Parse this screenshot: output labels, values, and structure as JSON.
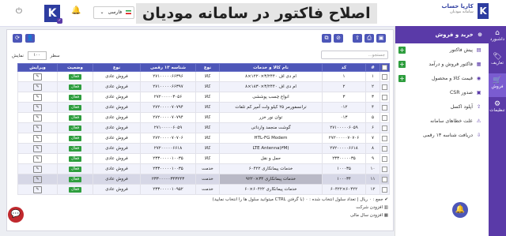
{
  "header": {
    "logo_text": "کارپا حساب",
    "logo_sub": "سامانه مودیان",
    "banner": "اصلاح فاکتور در سامانه مودیان",
    "language": "فارسی",
    "notification_count": "0"
  },
  "rail": [
    {
      "icon": "⌂",
      "label": "داشبورد",
      "icon_name": "home-icon"
    },
    {
      "icon": "🏷",
      "label": "تعاریف",
      "icon_name": "tag-icon"
    },
    {
      "icon": "🛒",
      "label": "فروش",
      "icon_name": "cart-icon"
    },
    {
      "icon": "⚙",
      "label": "تنظیمات",
      "icon_name": "gear-icon"
    }
  ],
  "menu": {
    "header": "خرید و فروش",
    "items": [
      {
        "label": "پیش فاکتور",
        "icon": "▤",
        "icon_name": "invoice-icon",
        "plus": true
      },
      {
        "label": "فاکتور فروش و درآمد",
        "icon": "▦",
        "icon_name": "receipt-icon",
        "plus": true
      },
      {
        "label": "قیمت کالا و محصول",
        "icon": "◉",
        "icon_name": "price-icon",
        "plus": true
      },
      {
        "label": "صدور CSR",
        "icon": "▣",
        "icon_name": "certificate-icon",
        "plus": false
      },
      {
        "label": "آپلود اکسل",
        "icon": "⇪",
        "icon_name": "upload-icon",
        "plus": false
      },
      {
        "label": "علت خطاهای سامانه",
        "icon": "⚠",
        "icon_name": "warning-icon",
        "plus": false
      },
      {
        "label": "دریافت شناسه ۱۳ رقمی",
        "icon": "⇩",
        "icon_name": "download-icon",
        "plus": false
      }
    ]
  },
  "toolbar": {
    "search_placeholder": "جستجو...",
    "show_label": "نمایش",
    "page_size": "۱۰۰",
    "rows_label": "سطر"
  },
  "table": {
    "headers": [
      "",
      "#",
      "کد",
      "نام کالا و خدمات",
      "نوع",
      "شناسه ۱۳ رقمی",
      "نوع",
      "وضعیت",
      "ویرایش"
    ],
    "rows": [
      [
        "۱",
        "۱",
        "ام دی اف ۳/۲۴۴۰×۱۲۲۰×۸",
        "کالا",
        "۲۷۱۰۰۰۰۰۶۶۳۹۶",
        "فروش عادی",
        "فعال"
      ],
      [
        "۲",
        "۲",
        "ام دی اف ۳/۲۴۴۰×۱۸۳۰×۸",
        "کالا",
        "۲۷۱۰۰۰۰۰۶۶۳۹۷",
        "فروش عادی",
        "فعال"
      ],
      [
        "۳",
        "۳",
        "انواع چسب پوششی",
        "کالا",
        "۲۷۲۰۰۰۰۰۳۰۵۶",
        "فروش عادی",
        "فعال"
      ],
      [
        "۴",
        "۰۱۲",
        "ترانسفورمر ۲۵ کیلو ولت آمپر کم تلفات",
        "کالا",
        "۲۷۲۰۰۰۰۰۷۰۷۹۴",
        "فروش عادی",
        "فعال"
      ],
      [
        "۵",
        "۰۱۳",
        "توان نور خزر",
        "کالا",
        "۲۷۲۰۰۰۰۰۷۰۷۹۴",
        "فروش عادی",
        "فعال"
      ],
      [
        "۶",
        "۲۷۱۰۰۰۰۰۶۰۵۹",
        "گوشت منجمد وارداتی",
        "کالا",
        "۲۷۱۰۰۰۰۰۶۰۵۹",
        "فروش عادی",
        "فعال"
      ],
      [
        "۷",
        "۲۷۲۰۰۰۰۰۷۰۷۰۶",
        "HTL-FG Modem",
        "کالا",
        "۲۷۲۰۰۰۰۰۷۰۷۰۶",
        "فروش عادی",
        "فعال"
      ],
      [
        "۸",
        "۲۷۲۰۰۰۰۰۶۶۱۸",
        "LTE Antenna(۳M)",
        "کالا",
        "۲۷۲۰۰۰۰۰۶۶۱۸",
        "فروش عادی",
        "فعال"
      ],
      [
        "۹",
        "۲۳۳۰۰۰۰۰۳۵",
        "حمل و نقل",
        "کالا",
        "۲۳۳۰۰۰۰۰۱۰۰۳۵",
        "فروش عادی",
        "فعال"
      ],
      [
        "۱۰",
        "۱۰۰۰۳۵",
        "خدمات پیمانکاری ۶۰۴۲۲",
        "خدمت",
        "۲۳۳۰۰۰۰۰۱۰۰۳۵",
        "فروش عادی",
        "فعال"
      ],
      [
        "۱۱",
        "۱۰۰۰۳۴",
        "خدمات پیمانکاری ۳۴×۹۲۲۰",
        "خدمت",
        "۲۳۳۰۰۰۰۰۳۴۳۲۴۳",
        "فروش عادی",
        "فعال"
      ],
      [
        "۱۲",
        "۶۰۴۲۲×۶۰۴۲۲",
        "خدمات پیمانکاری ۶۰۴۲۲×۶۰",
        "خدمت",
        "۲۳۳۰۰۰۰۰۱۰۹۵۲",
        "فروش عادی",
        "فعال"
      ]
    ],
    "edit_glyph": "✎"
  },
  "footer": {
    "sum_line": "جمع : ۰ ریال  |  تعداد سلول انتخاب شده : ۰ (با گرفتن CTRL میتوانید سلول ها را انتخاب نمایید)",
    "add_company": "افزودن شرکت",
    "add_fiscal_year": "افزودن سال مالی"
  }
}
